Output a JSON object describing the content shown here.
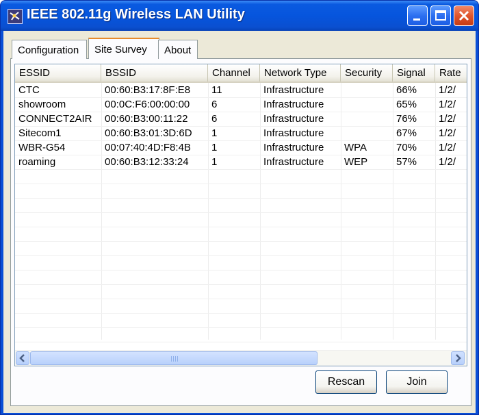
{
  "window": {
    "title": "IEEE 802.11g Wireless LAN Utility"
  },
  "tabs": [
    {
      "label": "Configuration"
    },
    {
      "label": "Site Survey"
    },
    {
      "label": "About"
    }
  ],
  "table": {
    "columns": [
      "ESSID",
      "BSSID",
      "Channel",
      "Network Type",
      "Security",
      "Signal",
      "Rate"
    ],
    "rows": [
      [
        "CTC",
        "00:60:B3:17:8F:E8",
        "11",
        "Infrastructure",
        "",
        "66%",
        "1/2/"
      ],
      [
        "showroom",
        "00:0C:F6:00:00:00",
        "6",
        "Infrastructure",
        "",
        "65%",
        "1/2/"
      ],
      [
        "CONNECT2AIR",
        "00:60:B3:00:11:22",
        "6",
        "Infrastructure",
        "",
        "76%",
        "1/2/"
      ],
      [
        "Sitecom1",
        "00:60:B3:01:3D:6D",
        "1",
        "Infrastructure",
        "",
        "67%",
        "1/2/"
      ],
      [
        "WBR-G54",
        "00:07:40:4D:F8:4B",
        "1",
        "Infrastructure",
        "WPA",
        "70%",
        "1/2/"
      ],
      [
        "roaming",
        "00:60:B3:12:33:24",
        "1",
        "Infrastructure",
        "WEP",
        "57%",
        "1/2/"
      ]
    ]
  },
  "buttons": {
    "rescan": "Rescan",
    "join": "Join"
  },
  "icons": {
    "app": "network-icon",
    "minimize": "minimize-icon",
    "maximize": "maximize-icon",
    "close": "close-icon",
    "scroll_left": "arrow-left-icon",
    "scroll_right": "arrow-right-icon"
  },
  "colors": {
    "titlebar": "#0655dd",
    "tab_accent": "#e68b2c",
    "close_button": "#e0552c"
  }
}
